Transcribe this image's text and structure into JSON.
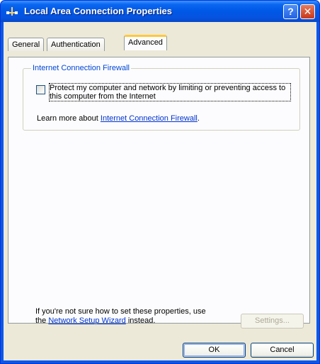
{
  "window": {
    "title": "Local Area Connection Properties",
    "help_glyph": "?",
    "close_glyph": "✕"
  },
  "tabs": [
    {
      "label": "General",
      "active": false
    },
    {
      "label": "Authentication",
      "active": false
    },
    {
      "label": "Advanced",
      "active": true
    }
  ],
  "firewall": {
    "group_label": "Internet Connection Firewall",
    "checkbox_checked": false,
    "checkbox_label": "Protect my computer and network by limiting or preventing access to this computer from the Internet",
    "learn_prefix": "Learn more about ",
    "learn_link": "Internet Connection Firewall",
    "learn_suffix": "."
  },
  "setup": {
    "text_line1": "If you're not sure how to set these properties, use",
    "text_prefix": "the ",
    "wizard_link": "Network Setup Wizard",
    "text_suffix": " instead.",
    "settings_label": "Settings..."
  },
  "buttons": {
    "ok_label": "OK",
    "cancel_label": "Cancel"
  },
  "colors": {
    "titlebar": "#0058e6",
    "dialog_bg": "#ece9d8",
    "active_tab_accent": "#ffc83c",
    "group_label": "#0046d5",
    "link": "#0033cc"
  },
  "icons": {
    "title_icon": "network-connection-icon"
  }
}
